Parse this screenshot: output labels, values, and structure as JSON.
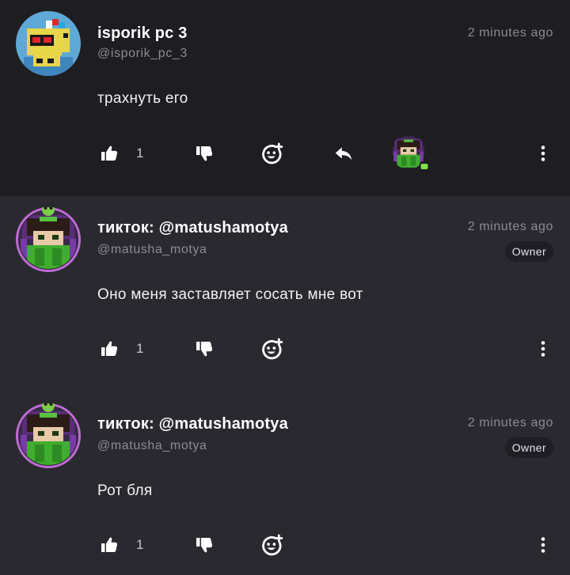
{
  "comments": [
    {
      "username": "isporik pc 3",
      "handle": "@isporik_pc_3",
      "timestamp": "2 minutes ago",
      "text": "трахнуть его",
      "likes": "1",
      "owner": false
    },
    {
      "username": "тикток: @matushamotya",
      "handle": "@matusha_motya",
      "timestamp": "2 minutes ago",
      "badge": "Owner",
      "text": "Оно меня заставляет сосать мне вот",
      "likes": "1",
      "owner": true
    },
    {
      "username": "тикток: @matushamotya",
      "handle": "@matusha_motya",
      "timestamp": "2 minutes ago",
      "badge": "Owner",
      "text": "Рот бля",
      "likes": "1",
      "owner": true
    }
  ],
  "colors": {
    "highlight_bg": "#1e1d22",
    "page_bg": "#2a2930",
    "muted_text": "#8c8b94",
    "owner_ring": "#c06bd6",
    "online_dot": "#7ee04a"
  },
  "icons": [
    "thumbs-up-icon",
    "thumbs-down-icon",
    "add-reaction-icon",
    "reply-icon",
    "more-vertical-icon"
  ]
}
